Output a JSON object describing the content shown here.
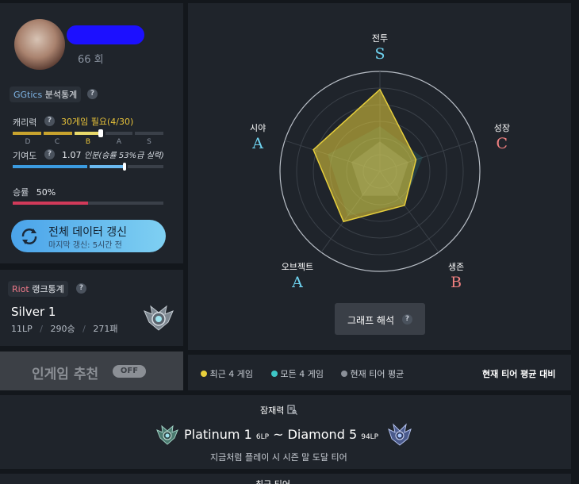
{
  "profile": {
    "games": "66 회"
  },
  "ggtics": {
    "badge_brand": "GGtics",
    "badge_label": "분석통계",
    "career_label": "캐리력",
    "career_value": "30게임 필요(4/30)",
    "tiers": [
      "D",
      "C",
      "B",
      "A",
      "S"
    ],
    "contribution_label": "기여도",
    "contribution_value": "1.07",
    "contribution_note": "인분(승률 53%급 실력)",
    "winrate_label": "승률",
    "winrate_value": "50%",
    "winrate_fraction": 0.5,
    "refresh_title": "전체 데이터 갱신",
    "refresh_sub": "마지막 갱신: 5시간 전"
  },
  "riot": {
    "badge_brand": "Riot",
    "badge_label": "랭크통계",
    "tier": "Silver 1",
    "lp": "11LP",
    "wins": "290승",
    "losses": "271패"
  },
  "ingame": {
    "label": "인게임 추천",
    "toggle": "OFF"
  },
  "radar": {
    "axes": [
      {
        "label": "전투",
        "grade": "S",
        "color": "#6fd3f0"
      },
      {
        "label": "성장",
        "grade": "C",
        "color": "#f08080"
      },
      {
        "label": "생존",
        "grade": "B",
        "color": "#f08080"
      },
      {
        "label": "오브젝트",
        "grade": "A",
        "color": "#6fd3f0"
      },
      {
        "label": "시야",
        "grade": "A",
        "color": "#6fd3f0"
      }
    ],
    "recent_values": [
      0.82,
      0.38,
      0.42,
      0.62,
      0.7
    ],
    "all_values": [
      0.45,
      0.45,
      0.4,
      0.55,
      0.55
    ],
    "tier_avg_values": [
      0.3,
      0.3,
      0.3,
      0.3,
      0.3
    ],
    "analysis_button": "그래프 해석"
  },
  "legend": {
    "recent": "최근 4 게임",
    "all": "모든 4 게임",
    "avg": "현재 티어 평균",
    "compare": "현재 티어 평균 대비",
    "colors": {
      "recent": "#e7cf3c",
      "all": "#3ec7c7",
      "avg": "#8a8f98"
    }
  },
  "potential": {
    "title": "잠재력",
    "from_tier": "Platinum 1",
    "from_lp": "6LP",
    "sep": "~",
    "to_tier": "Diamond 5",
    "to_lp": "94LP",
    "desc": "지금처럼 플레이 시 시즌 말 도달 티어"
  },
  "next_section": {
    "title": "최근 티어"
  }
}
